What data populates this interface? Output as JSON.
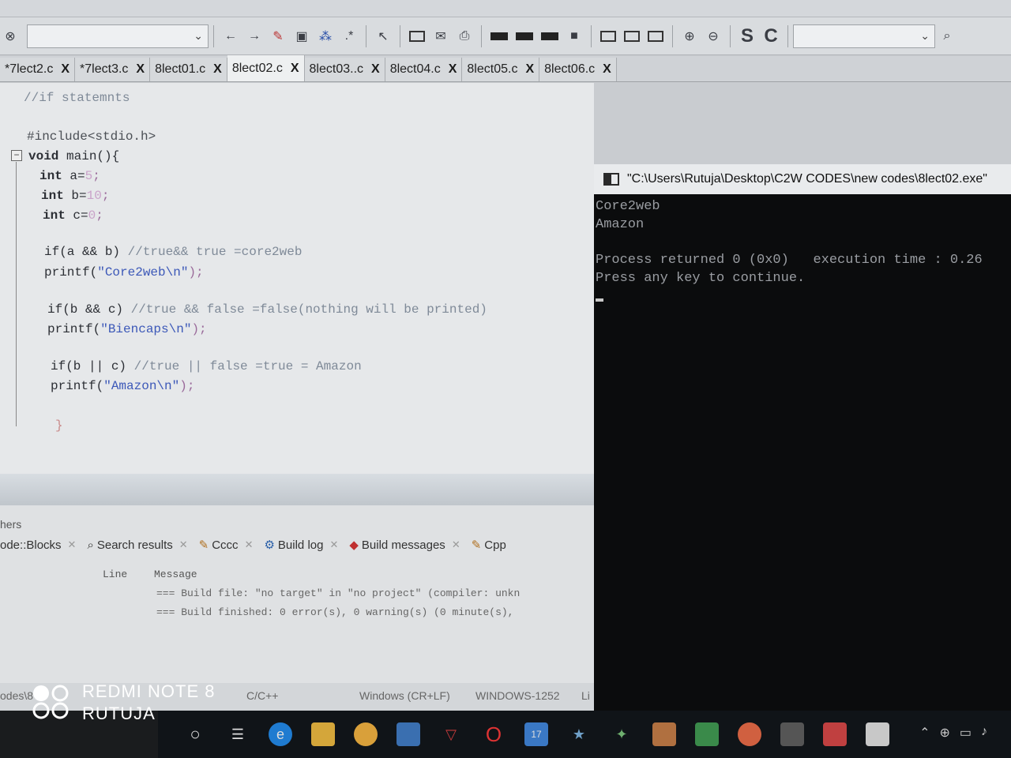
{
  "toolbar": {
    "search_icon": "search-icon",
    "s_label": "S",
    "c_label": "C"
  },
  "tabs": [
    {
      "label": "*7lect2.c",
      "close": "X"
    },
    {
      "label": "*7lect3.c",
      "close": "X"
    },
    {
      "label": "8lect01.c",
      "close": "X"
    },
    {
      "label": "8lect02.c",
      "close": "X",
      "active": true
    },
    {
      "label": "8lect03..c",
      "close": "X"
    },
    {
      "label": "8lect04.c",
      "close": "X"
    },
    {
      "label": "8lect05.c",
      "close": "X"
    },
    {
      "label": "8lect06.c",
      "close": "X"
    }
  ],
  "code": {
    "l1": "//if statemnts",
    "l2": "#include<stdio.h>",
    "l3_kw": "void",
    "l3_rest": " main(){",
    "l4_kw": "int",
    "l4_rest": " a=",
    "l4_num": "5",
    "l5_kw": "int",
    "l5_rest": " b=",
    "l5_num": "10",
    "l6_kw": "int",
    "l6_rest": " c=",
    "l6_num": "0",
    "l7_code": "if(a && b)",
    "l7_comment": " //true&& true =core2web",
    "l8_fn": "printf(",
    "l8_str": "\"Core2web\\n\"",
    "l8_end": ");",
    "l9_code": "if(b && c)",
    "l9_comment": " //true && false =false(nothing will be printed)",
    "l10_fn": "printf(",
    "l10_str": "\"Biencaps\\n\"",
    "l10_end": ");",
    "l11_code": "if(b || c)",
    "l11_comment": " //true || false =true = Amazon",
    "l12_fn": "printf(",
    "l12_str": "\"Amazon\\n\"",
    "l12_end": ");",
    "l13": "}"
  },
  "logs": {
    "panel_title": "hers",
    "tabs": {
      "codeblocks": "ode::Blocks",
      "search": "Search results",
      "cccc": "Cccc",
      "buildlog": "Build log",
      "buildmsg": "Build messages",
      "cpp": "Cpp"
    },
    "col_line": "Line",
    "col_message": "Message",
    "msg1": "=== Build file: \"no target\" in \"no project\" (compiler: unkn",
    "msg2": "=== Build finished: 0 error(s), 0 warning(s) (0 minute(s),"
  },
  "status": {
    "path": "odes\\8",
    "lang": "C/C++",
    "eol": "Windows (CR+LF)",
    "enc": "WINDOWS-1252",
    "li": "Li"
  },
  "console": {
    "title": "\"C:\\Users\\Rutuja\\Desktop\\C2W CODES\\new codes\\8lect02.exe\"",
    "out1": "Core2web",
    "out2": "Amazon",
    "out3": "Process returned 0 (0x0)   execution time : 0.26",
    "out4": "Press any key to continue."
  },
  "watermark": {
    "line1": "REDMI NOTE 8",
    "line2": "RUTUJA"
  },
  "taskbar": {
    "badge": "17"
  }
}
